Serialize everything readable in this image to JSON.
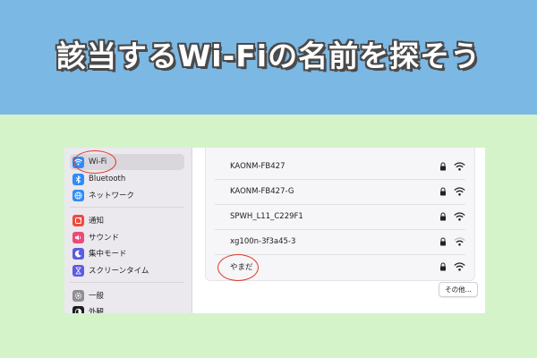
{
  "banner": {
    "title": "該当するWi-Fiの名前を探そう",
    "bg_color": "#7cb8e4",
    "text_color": "#ffffff",
    "outline_color": "#4a4a4a"
  },
  "sidebar": {
    "items": [
      {
        "label": "Wi-Fi",
        "icon": "wifi-icon",
        "icon_color": "#2f8cf7",
        "selected": true
      },
      {
        "label": "Bluetooth",
        "icon": "bluetooth-icon",
        "icon_color": "#2f8cf7"
      },
      {
        "label": "ネットワーク",
        "icon": "globe-icon",
        "icon_color": "#2f8cf7"
      },
      {
        "label": "通知",
        "icon": "bell-icon",
        "icon_color": "#ef4b3f"
      },
      {
        "label": "サウンド",
        "icon": "speaker-icon",
        "icon_color": "#ee4a78"
      },
      {
        "label": "集中モード",
        "icon": "moon-icon",
        "icon_color": "#5b5ce0"
      },
      {
        "label": "スクリーンタイム",
        "icon": "hourglass-icon",
        "icon_color": "#5b5ce0"
      },
      {
        "label": "一般",
        "icon": "gear-icon",
        "icon_color": "#8e8e93"
      },
      {
        "label": "外観",
        "icon": "appearance-icon",
        "icon_color": "#1c1c1e"
      }
    ]
  },
  "networks": [
    {
      "name": "KAONM-FB427",
      "secured": true,
      "signal": "strong"
    },
    {
      "name": "KAONM-FB427-G",
      "secured": true,
      "signal": "strong"
    },
    {
      "name": "SPWH_L11_C229F1",
      "secured": true,
      "signal": "strong"
    },
    {
      "name": "xg100n-3f3a45-3",
      "secured": true,
      "signal": "weak"
    },
    {
      "name": "やまだ",
      "secured": true,
      "signal": "strong"
    }
  ],
  "other_button": {
    "label": "その他..."
  },
  "highlight_color": "#e0392b"
}
